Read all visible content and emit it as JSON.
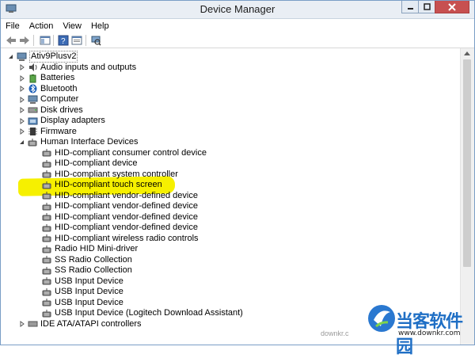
{
  "window": {
    "title": "Device Manager"
  },
  "menu": [
    "File",
    "Action",
    "View",
    "Help"
  ],
  "toolbar": [
    "back-icon",
    "forward-icon",
    "show-hide-console-tree-icon",
    "help-icon",
    "properties-icon",
    "scan-hardware-icon"
  ],
  "tree": {
    "root": "Ativ9Plusv2",
    "categories": [
      "Audio inputs and outputs",
      "Batteries",
      "Bluetooth",
      "Computer",
      "Disk drives",
      "Display adapters",
      "Firmware",
      "Human Interface Devices"
    ],
    "hid_children": [
      "HID-compliant consumer control device",
      "HID-compliant device",
      "HID-compliant system controller",
      "HID-compliant touch screen",
      "HID-compliant vendor-defined device",
      "HID-compliant vendor-defined device",
      "HID-compliant vendor-defined device",
      "HID-compliant vendor-defined device",
      "HID-compliant wireless radio controls",
      "Radio HID Mini-driver",
      "SS Radio Collection",
      "SS Radio Collection",
      "USB Input Device",
      "USB Input Device",
      "USB Input Device",
      "USB Input Device (Logitech Download Assistant)"
    ],
    "after": "IDE ATA/ATAPI controllers",
    "highlighted": "HID-compliant touch screen"
  },
  "watermark": {
    "text": "当客软件园",
    "url": "www.downkr.com",
    "url_partial": "downkr.c"
  },
  "colors": {
    "highlight": "#f6f000",
    "close_button": "#c75050",
    "watermark_blue": "#1f6fc5"
  }
}
